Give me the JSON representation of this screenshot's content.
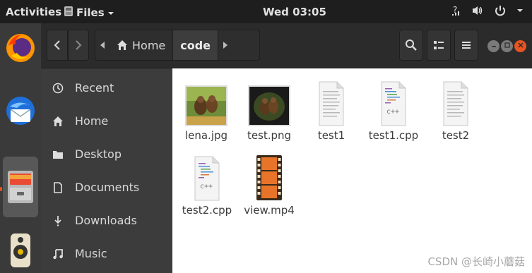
{
  "topbar": {
    "activities": "Activities",
    "app_name": "Files",
    "clock": "Wed 03:05"
  },
  "header": {
    "path": [
      {
        "label": "Home",
        "icon": "home-icon"
      },
      {
        "label": "code"
      }
    ]
  },
  "sidebar": {
    "items": [
      {
        "label": "Recent",
        "icon": "clock-icon"
      },
      {
        "label": "Home",
        "icon": "home-icon"
      },
      {
        "label": "Desktop",
        "icon": "folder-icon"
      },
      {
        "label": "Documents",
        "icon": "document-icon"
      },
      {
        "label": "Downloads",
        "icon": "download-icon"
      },
      {
        "label": "Music",
        "icon": "music-icon"
      }
    ]
  },
  "files": [
    {
      "name": "lena.jpg",
      "type": "image"
    },
    {
      "name": "test.png",
      "type": "image"
    },
    {
      "name": "test1",
      "type": "text"
    },
    {
      "name": "test1.cpp",
      "type": "cpp",
      "badge": "c++"
    },
    {
      "name": "test2",
      "type": "text"
    },
    {
      "name": "test2.cpp",
      "type": "cpp",
      "badge": "c++"
    },
    {
      "name": "view.mp4",
      "type": "video"
    }
  ],
  "watermark": "CSDN @长崎小蘑菇",
  "colors": {
    "accent": "#e95420",
    "topbar": "#1e1e1e",
    "sidebar": "#3c3c3c",
    "content": "#ffffff"
  }
}
